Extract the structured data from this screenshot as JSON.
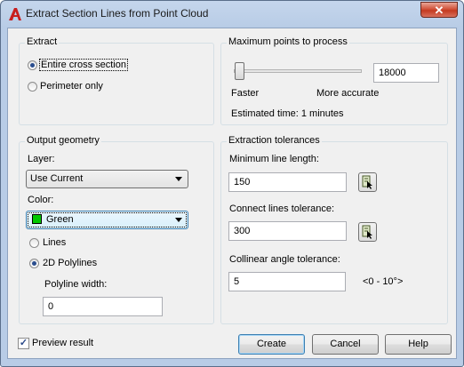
{
  "window": {
    "title": "Extract Section Lines from Point Cloud",
    "close_glyph": "✕"
  },
  "extract": {
    "title": "Extract",
    "entire_label": "Entire cross section",
    "perimeter_label": "Perimeter only",
    "selected": "entire"
  },
  "max_points": {
    "title": "Maximum points to process",
    "value": "18000",
    "faster_label": "Faster",
    "accurate_label": "More accurate",
    "estimated_time": "Estimated time: 1 minutes",
    "slider_level": 0.05
  },
  "output": {
    "title": "Output geometry",
    "layer_label": "Layer:",
    "layer_value": "Use Current",
    "color_label": "Color:",
    "color_value": "Green",
    "color_hex": "#00c800",
    "lines_label": "Lines",
    "polylines_label": "2D Polylines",
    "selected": "polylines",
    "width_label": "Polyline width:",
    "width_value": "0"
  },
  "tolerances": {
    "title": "Extraction tolerances",
    "min_length_label": "Minimum line length:",
    "min_length_value": "150",
    "connect_label": "Connect lines tolerance:",
    "connect_value": "300",
    "collinear_label": "Collinear angle tolerance:",
    "collinear_value": "5",
    "collinear_range": "<0 - 10°>"
  },
  "footer": {
    "preview_label": "Preview result",
    "preview_checked": true,
    "create_label": "Create",
    "cancel_label": "Cancel",
    "help_label": "Help"
  },
  "accent": {
    "app_icon_red": "#c81e1e"
  }
}
